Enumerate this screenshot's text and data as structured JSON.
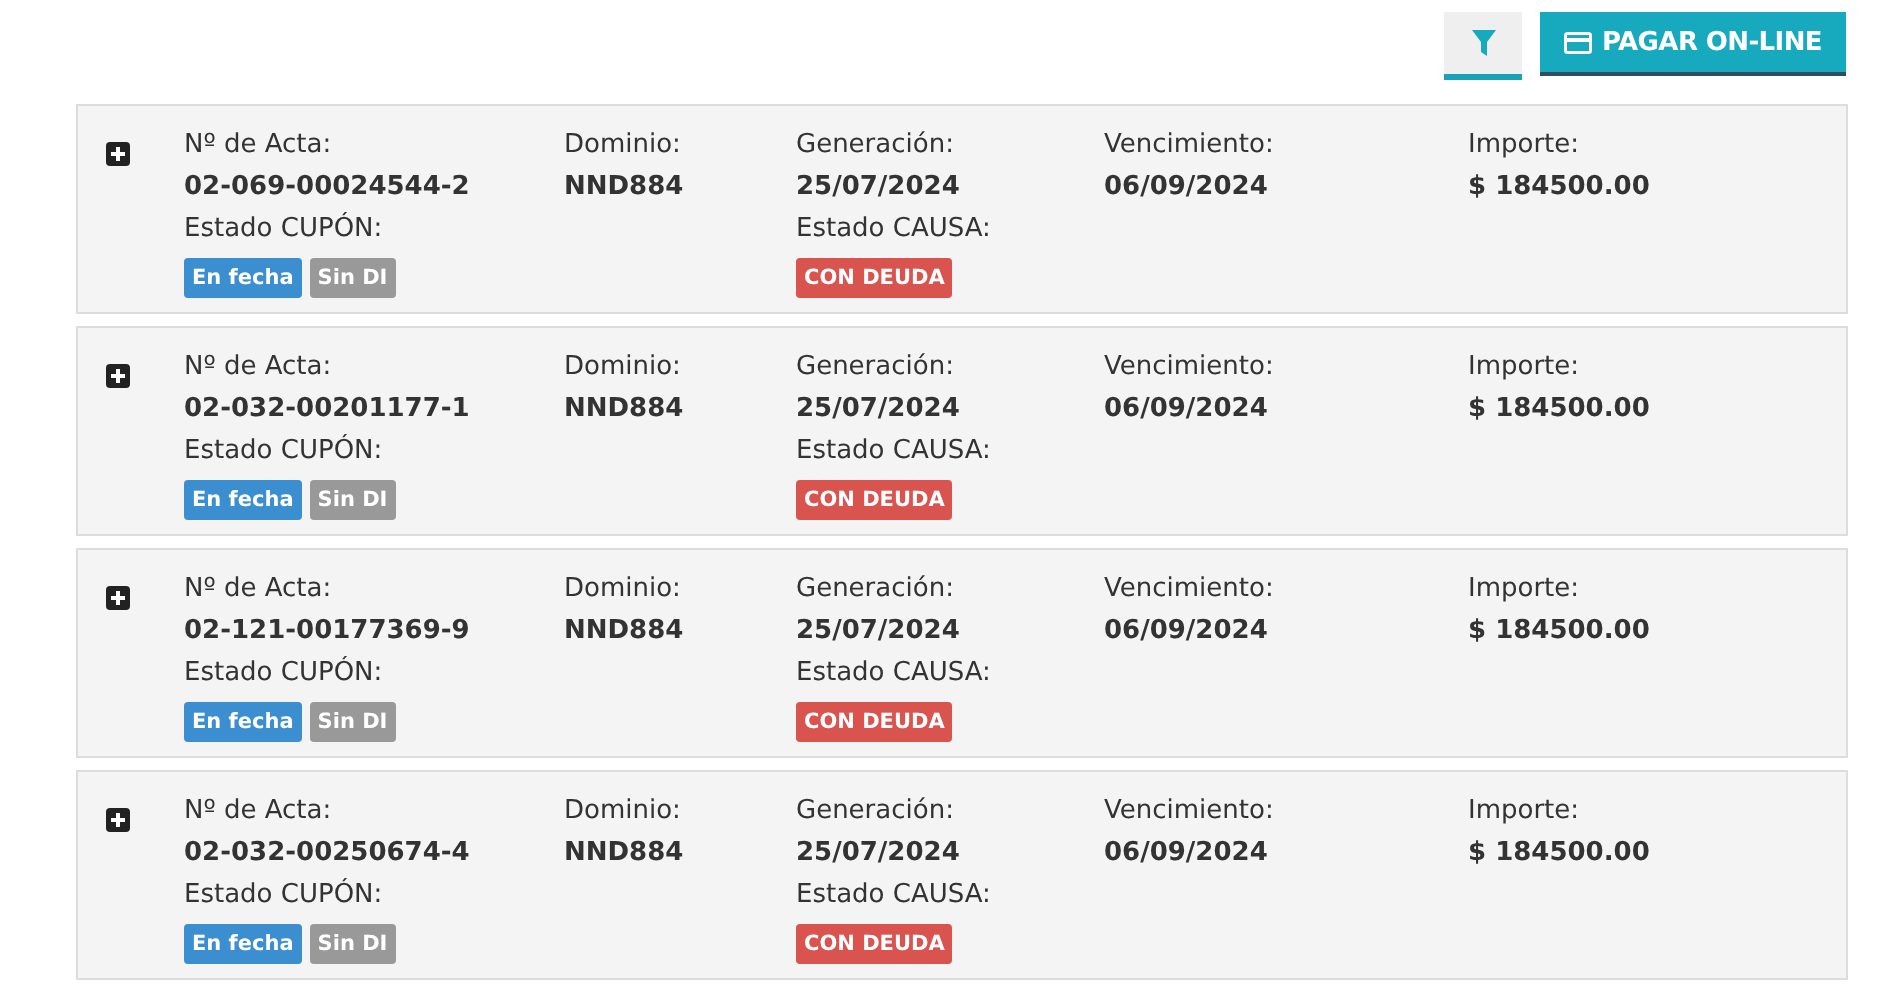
{
  "toolbar": {
    "filter": {
      "selected": true
    },
    "pay_button": {
      "label": "PAGAR ON-LINE"
    }
  },
  "cards": [
    {
      "acta_label": "Nº de Acta:",
      "acta": "02-069-00024544-2",
      "dominio_label": "Dominio:",
      "dominio": "NND884",
      "generacion_label": "Generación:",
      "generacion": "25/07/2024",
      "vencimiento_label": "Vencimiento:",
      "vencimiento": "06/09/2024",
      "importe_label": "Importe:",
      "importe": "$ 184500.00",
      "cupon_label": "Estado CUPÓN:",
      "cupon_badges": [
        {
          "text": "En fecha",
          "color": "#3b8fd1"
        },
        {
          "text": "Sin DI",
          "color": "#999999"
        }
      ],
      "causa_label": "Estado CAUSA:",
      "causa_badges": [
        {
          "text": "CON DEUDA",
          "color": "#d9534f"
        }
      ]
    },
    {
      "acta_label": "Nº de Acta:",
      "acta": "02-032-00201177-1",
      "dominio_label": "Dominio:",
      "dominio": "NND884",
      "generacion_label": "Generación:",
      "generacion": "25/07/2024",
      "vencimiento_label": "Vencimiento:",
      "vencimiento": "06/09/2024",
      "importe_label": "Importe:",
      "importe": "$ 184500.00",
      "cupon_label": "Estado CUPÓN:",
      "cupon_badges": [
        {
          "text": "En fecha",
          "color": "#3b8fd1"
        },
        {
          "text": "Sin DI",
          "color": "#999999"
        }
      ],
      "causa_label": "Estado CAUSA:",
      "causa_badges": [
        {
          "text": "CON DEUDA",
          "color": "#d9534f"
        }
      ]
    },
    {
      "acta_label": "Nº de Acta:",
      "acta": "02-121-00177369-9",
      "dominio_label": "Dominio:",
      "dominio": "NND884",
      "generacion_label": "Generación:",
      "generacion": "25/07/2024",
      "vencimiento_label": "Vencimiento:",
      "vencimiento": "06/09/2024",
      "importe_label": "Importe:",
      "importe": "$ 184500.00",
      "cupon_label": "Estado CUPÓN:",
      "cupon_badges": [
        {
          "text": "En fecha",
          "color": "#3b8fd1"
        },
        {
          "text": "Sin DI",
          "color": "#999999"
        }
      ],
      "causa_label": "Estado CAUSA:",
      "causa_badges": [
        {
          "text": "CON DEUDA",
          "color": "#d9534f"
        }
      ]
    },
    {
      "acta_label": "Nº de Acta:",
      "acta": "02-032-00250674-4",
      "dominio_label": "Dominio:",
      "dominio": "NND884",
      "generacion_label": "Generación:",
      "generacion": "25/07/2024",
      "vencimiento_label": "Vencimiento:",
      "vencimiento": "06/09/2024",
      "importe_label": "Importe:",
      "importe": "$ 184500.00",
      "cupon_label": "Estado CUPÓN:",
      "cupon_badges": [
        {
          "text": "En fecha",
          "color": "#3b8fd1"
        },
        {
          "text": "Sin DI",
          "color": "#999999"
        }
      ],
      "causa_label": "Estado CAUSA:",
      "causa_badges": [
        {
          "text": "CON DEUDA",
          "color": "#d9534f"
        }
      ]
    }
  ]
}
